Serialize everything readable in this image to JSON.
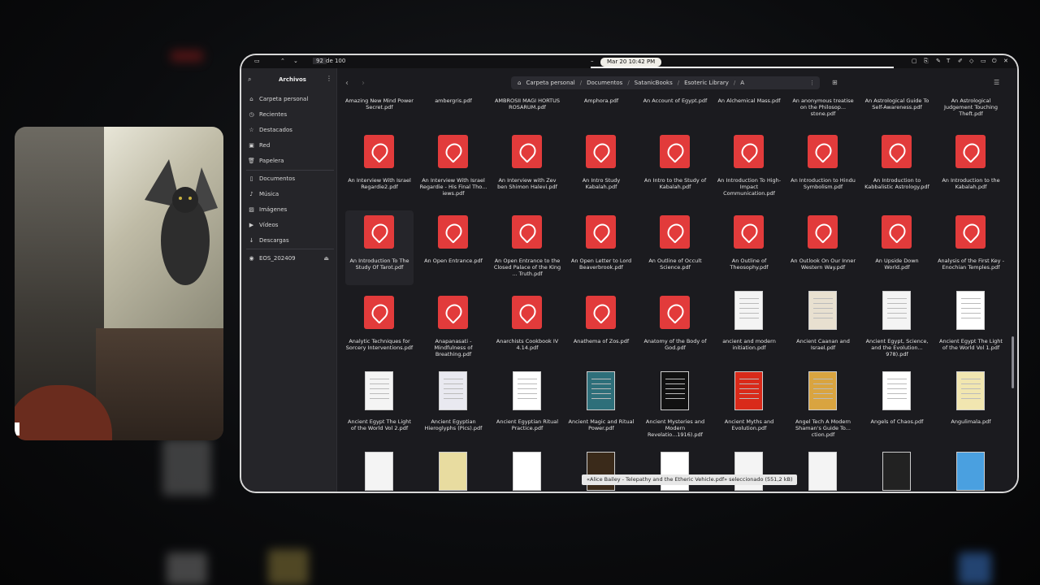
{
  "topbar": {
    "page_value": "92",
    "page_of": "de 100",
    "clock": "Mar 20  10:42 PM"
  },
  "sidebar": {
    "title": "Archivos",
    "items": [
      {
        "label": "Carpeta personal",
        "icon": "home-icon"
      },
      {
        "label": "Recientes",
        "icon": "clock-icon"
      },
      {
        "label": "Destacados",
        "icon": "star-icon"
      },
      {
        "label": "Red",
        "icon": "network-icon"
      },
      {
        "label": "Papelera",
        "icon": "trash-icon"
      },
      {
        "label": "Documentos",
        "icon": "document-icon"
      },
      {
        "label": "Música",
        "icon": "music-icon"
      },
      {
        "label": "Imágenes",
        "icon": "image-icon"
      },
      {
        "label": "Vídeos",
        "icon": "video-icon"
      },
      {
        "label": "Descargas",
        "icon": "download-icon"
      },
      {
        "label": "EOS_202409",
        "icon": "drive-icon"
      }
    ]
  },
  "path": [
    "Carpeta personal",
    "Documentos",
    "SatanicBooks",
    "Esoteric Library",
    "A"
  ],
  "top_row": [
    "Amazing New Mind Power Secret.pdf",
    "ambergris.pdf",
    "AMBROSII MAGI HORTUS ROSARUM.pdf",
    "Amphora.pdf",
    "An Account of Egypt.pdf",
    "An Alchemical Mass.pdf",
    "An anonymous treatise on the Philosop... stone.pdf",
    "An Astrological Guide To Self-Awareness.pdf",
    "An Astrological Judgement Touching Theft.pdf"
  ],
  "rows": [
    [
      {
        "name": "An Interview With Israel Regardie2.pdf",
        "kind": "pdf"
      },
      {
        "name": "An Interview With Israel Regardie - His Final Tho... iews.pdf",
        "kind": "pdf"
      },
      {
        "name": "An Interview with Zev ben Shimon Halevi.pdf",
        "kind": "pdf"
      },
      {
        "name": "An Intro Study Kabalah.pdf",
        "kind": "pdf"
      },
      {
        "name": "An Intro to the Study of Kabalah.pdf",
        "kind": "pdf"
      },
      {
        "name": "An Introduction To High-Impact Communication.pdf",
        "kind": "pdf"
      },
      {
        "name": "An Introduction to Hindu Symbolism.pdf",
        "kind": "pdf"
      },
      {
        "name": "An Introduction to Kabbalistic Astrology.pdf",
        "kind": "pdf"
      },
      {
        "name": "An Introduction to the Kabalah.pdf",
        "kind": "pdf"
      }
    ],
    [
      {
        "name": "An Introduction To The Study Of Tarot.pdf",
        "kind": "pdf"
      },
      {
        "name": "An Open Entrance.pdf",
        "kind": "pdf"
      },
      {
        "name": "An Open Entrance to the Closed Palace of the King ... Truth.pdf",
        "kind": "pdf"
      },
      {
        "name": "An Open Letter to Lord Beaverbrook.pdf",
        "kind": "pdf"
      },
      {
        "name": "An Outline of Occult Science.pdf",
        "kind": "pdf"
      },
      {
        "name": "An Outline of Theosophy.pdf",
        "kind": "pdf"
      },
      {
        "name": "An Outlook On Our Inner Western Way.pdf",
        "kind": "pdf"
      },
      {
        "name": "An Upside Down World.pdf",
        "kind": "pdf"
      },
      {
        "name": "Analysis of the First Key - Enochian Temples.pdf",
        "kind": "pdf"
      }
    ],
    [
      {
        "name": "Analytic Techniques for Sorcery Interventions.pdf",
        "kind": "pdf"
      },
      {
        "name": "Anapanasati - Mindfulness of Breathing.pdf",
        "kind": "pdf"
      },
      {
        "name": "Anarchists Cookbook IV 4.14.pdf",
        "kind": "pdf"
      },
      {
        "name": "Anathema of Zos.pdf",
        "kind": "pdf"
      },
      {
        "name": "Anatomy of the Body of God.pdf",
        "kind": "pdf"
      },
      {
        "name": "ancient and modern initiation.pdf",
        "kind": "thumb"
      },
      {
        "name": "Ancient Caanan and Israel.pdf",
        "kind": "thumb"
      },
      {
        "name": "Ancient Egypt, Science, and the Evolution... 978).pdf",
        "kind": "thumb"
      },
      {
        "name": "Ancient Egypt The Light of the World Vol 1.pdf",
        "kind": "thumb"
      }
    ],
    [
      {
        "name": "Ancient Egypt The Light of the World Vol 2.pdf",
        "kind": "thumb"
      },
      {
        "name": "Ancient Egyptian Hieroglyphs (Pics).pdf",
        "kind": "thumb"
      },
      {
        "name": "Ancient Egyptian Ritual Practice.pdf",
        "kind": "thumb"
      },
      {
        "name": "Ancient Magic and Ritual Power.pdf",
        "kind": "thumb"
      },
      {
        "name": "Ancient Mysteries and Modern Revelatio...1916).pdf",
        "kind": "thumb"
      },
      {
        "name": "Ancient Myths and Evolution.pdf",
        "kind": "thumb"
      },
      {
        "name": "Angel Tech A Modern Shaman's Guide To... ction.pdf",
        "kind": "thumb"
      },
      {
        "name": "Angels of Chaos.pdf",
        "kind": "thumb"
      },
      {
        "name": "Angulimala.pdf",
        "kind": "thumb"
      }
    ]
  ],
  "status": "«Alice Bailey - Telepathy and the Etheric Vehicle.pdf» seleccionado  (551,2 kB)"
}
